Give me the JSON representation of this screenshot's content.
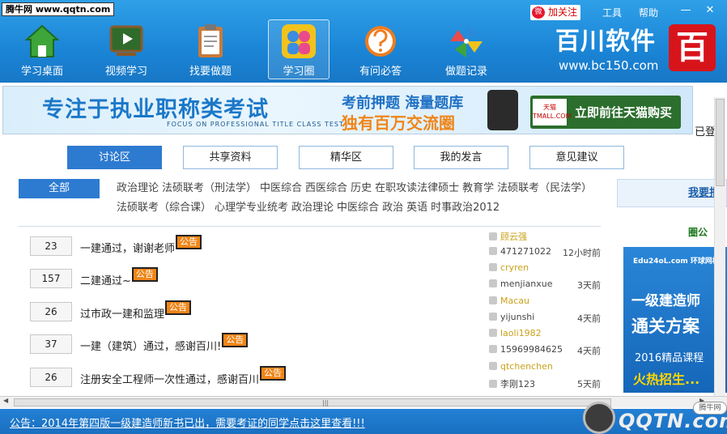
{
  "window": {
    "site_tag": "腾牛网 www.qqtn.com",
    "weibo_icon": "weibo-icon",
    "follow_label": "加关注",
    "tools_label": "工具",
    "help_label": "帮助",
    "minimize": "—",
    "close": "✕"
  },
  "nav": {
    "items": [
      {
        "label": "学习桌面",
        "icon": "home-icon",
        "color": "#3da53a"
      },
      {
        "label": "视频学习",
        "icon": "blackboard-icon",
        "color": "#2f6b2a"
      },
      {
        "label": "找要做题",
        "icon": "clipboard-icon",
        "color": "#c97a3a"
      },
      {
        "label": "学习圈",
        "icon": "people-icon",
        "color": "#f2a21c"
      },
      {
        "label": "有问必答",
        "icon": "question-face-icon",
        "color": "#ef7d1e"
      },
      {
        "label": "做题记录",
        "icon": "pinwheel-icon",
        "color": "#2a8ad8"
      }
    ],
    "active_index": 3
  },
  "brand": {
    "name": "百川软件",
    "url": "www.bc150.com",
    "logo_char": "百"
  },
  "banner": {
    "main": "专注于执业职称类考试",
    "sub": "FOCUS ON PROFESSIONAL TITLE CLASS TEST",
    "line1": "考前押题  海量题库",
    "line2": "独有百万交流圈",
    "tmall_logo": "天猫 TMALL.COM",
    "tmall_cta": "立即前往天猫购买"
  },
  "logged_in_text": "已登",
  "tabs": [
    "讨论区",
    "共享资料",
    "精华区",
    "我的发言",
    "意见建议"
  ],
  "active_tab": 0,
  "categories": {
    "all_label": "全部",
    "items": [
      "政治理论",
      "法硕联考（刑法学）",
      "中医综合",
      "西医综合",
      "历史",
      "在职攻读法律硕士",
      "教育学",
      "法硕联考（民法学）",
      "法硕联考（综合课）",
      "心理学专业统考",
      "政治理论",
      "中医综合",
      "政治",
      "英语",
      "时事政治2012"
    ]
  },
  "posts": [
    {
      "count": "23",
      "title": "一建通过，谢谢老师",
      "badge": "公告",
      "user": "顾云强",
      "replier": "471271022",
      "time": "12小时前"
    },
    {
      "count": "157",
      "title": "二建通过~",
      "badge": "公告",
      "user": "cryren",
      "replier": "menjianxue",
      "time": "3天前"
    },
    {
      "count": "26",
      "title": "过市政一建和监理",
      "badge": "公告",
      "user": "Macau",
      "replier": "yijunshi",
      "time": "4天前"
    },
    {
      "count": "37",
      "title": "一建（建筑）通过，感谢百川!",
      "badge": "公告",
      "user": "laoli1982",
      "replier": "15969984625",
      "time": "4天前"
    },
    {
      "count": "26",
      "title": "注册安全工程师一次性通过，感谢百川",
      "badge": "公告",
      "user": "qtchenchen",
      "replier": "李刚123",
      "time": "5天前"
    }
  ],
  "sidebar": {
    "post_button": "我要报",
    "announce_title": "圈公",
    "ad": {
      "logo": "Edu24oL.com 环球网校",
      "line1": "一级建造师",
      "line2": "通关方案",
      "line3": "2016精品课程",
      "line4": "火热招生..."
    }
  },
  "statusbar": {
    "announcement": "公告：2014年第四版一级建造师新书已出，需要考证的同学点击这里查看!!!"
  },
  "watermark": {
    "text": "QQTN.com",
    "tag": "腾牛网"
  }
}
